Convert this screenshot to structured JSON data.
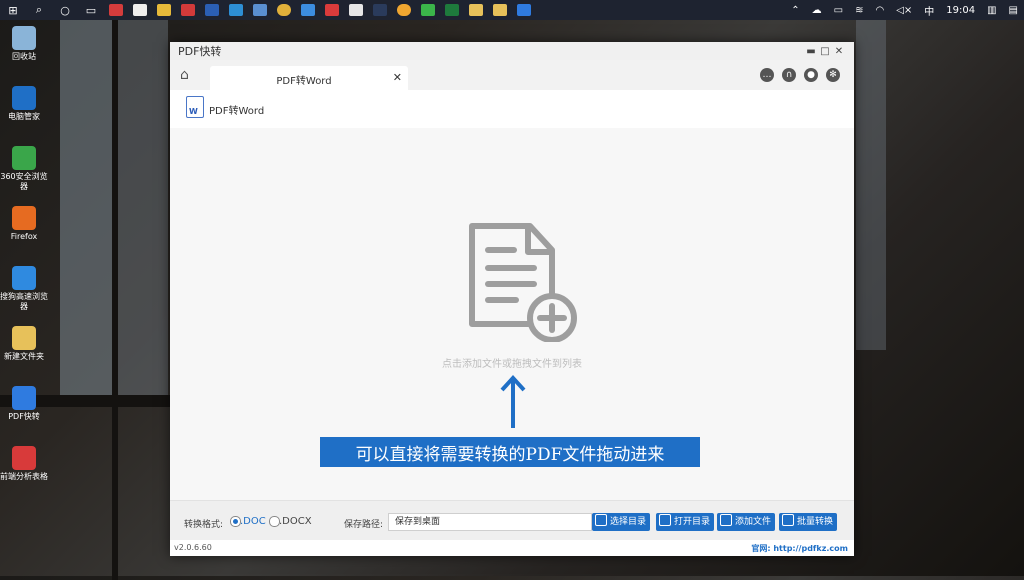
{
  "taskbar": {
    "ime": "中",
    "time": "19:04"
  },
  "desktop": {
    "icons": [
      {
        "label": "回收站",
        "icon": "recycle-bin-icon",
        "color": "#8ab4d8"
      },
      {
        "label": "电脑管家",
        "icon": "pc-manager-icon",
        "color": "#1f6fc6"
      },
      {
        "label": "360安全浏览器",
        "icon": "browser-360-icon",
        "color": "#3aa64a"
      },
      {
        "label": "Firefox",
        "icon": "firefox-icon",
        "color": "#e66b21"
      },
      {
        "label": "搜狗高速浏览器",
        "icon": "sogou-browser-icon",
        "color": "#2f8ae0"
      },
      {
        "label": "新建文件夹",
        "icon": "folder-icon",
        "color": "#e7c15a"
      },
      {
        "label": "PDF快转",
        "icon": "pdf-converter-icon",
        "color": "#2f7be0"
      },
      {
        "label": "前端分析表格",
        "icon": "pdf-file-icon",
        "color": "#d83a3a"
      }
    ]
  },
  "app": {
    "title": "PDF快转",
    "tab_label": "PDF转Word",
    "tab_close": "✕",
    "sub_title": "PDF转Word",
    "sub_icon_letter": "W",
    "drop_hint": "点击添加文件或拖拽文件到列表",
    "annotation_banner": "可以直接将需要转换的PDF文件拖动进来",
    "format_label": "转换格式:",
    "formats": [
      ".DOC",
      ".DOCX"
    ],
    "selected_format": ".DOC",
    "save_path_label": "保存路径:",
    "save_path_value": "保存到桌面",
    "buttons": {
      "choose_dir": "选择目录",
      "open_dir": "打开目录",
      "add_file": "添加文件",
      "batch_convert": "批量转换"
    },
    "version": "v2.0.6.60",
    "website": "官网: http://pdfkz.com",
    "accent_color": "#1f6fc6"
  }
}
